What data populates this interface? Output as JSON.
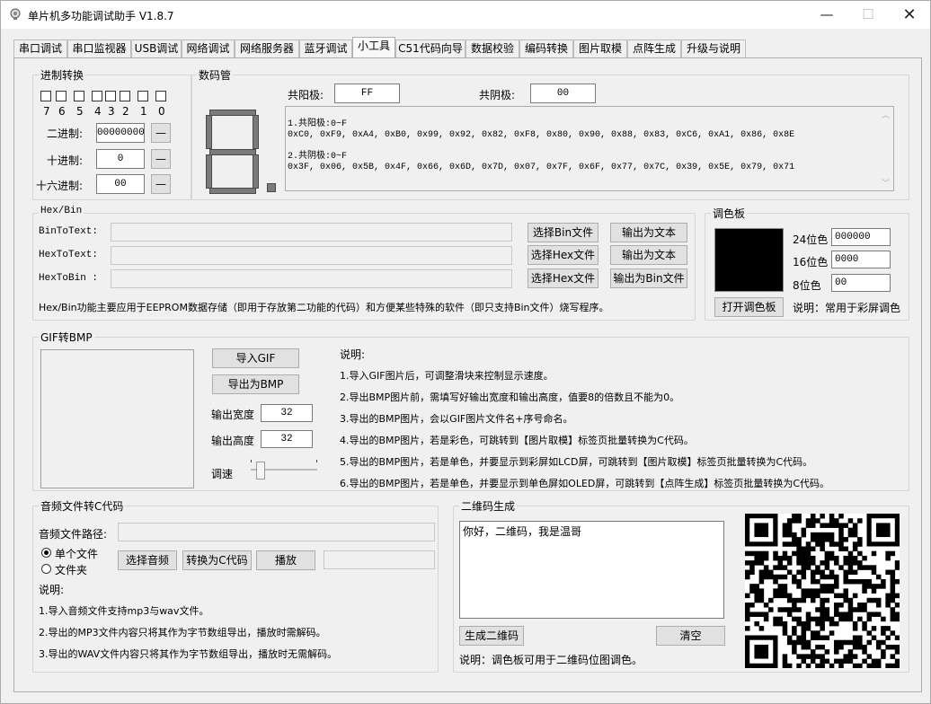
{
  "window": {
    "title": "单片机多功能调试助手 V1.8.7"
  },
  "tabs": [
    "串口调试",
    "串口监视器",
    "USB调试",
    "网络调试",
    "网络服务器",
    "蓝牙调试",
    "小工具",
    "C51代码向导",
    "数据校验",
    "编码转换",
    "图片取模",
    "点阵生成",
    "升级与说明"
  ],
  "base_convert": {
    "title": "进制转换",
    "bit_labels": [
      "7",
      "6",
      "5",
      "4",
      "3",
      "2",
      "1",
      "0"
    ],
    "binary_label": "二进制:",
    "binary_value": "00000000",
    "decimal_label": "十进制:",
    "decimal_value": "0",
    "hex_label": "十六进制:",
    "hex_value": "00",
    "minus_label": "—"
  },
  "seven_seg": {
    "title": "数码管",
    "common_anode_label": "共阳极:",
    "common_anode_value": "FF",
    "common_cathode_label": "共阴极:",
    "common_cathode_value": "00",
    "output_lines": [
      "1.共阳极:0~F",
      "0xC0, 0xF9, 0xA4, 0xB0, 0x99, 0x92, 0x82, 0xF8, 0x80, 0x90, 0x88, 0x83, 0xC6, 0xA1, 0x86, 0x8E",
      "",
      "2.共阴极:0~F",
      "0x3F, 0x06, 0x5B, 0x4F, 0x66, 0x6D, 0x7D, 0x07, 0x7F, 0x6F, 0x77, 0x7C, 0x39, 0x5E, 0x79, 0x71"
    ]
  },
  "hexbin": {
    "title": "Hex/Bin",
    "bin_to_text_label": "BinToText:",
    "hex_to_text_label": "HexToText:",
    "hex_to_bin_label": "HexToBin :",
    "select_bin": "选择Bin文件",
    "select_hex": "选择Hex文件",
    "output_text": "输出为文本",
    "output_bin": "输出为Bin文件",
    "note": "Hex/Bin功能主要应用于EEPROM数据存储（即用于存放第二功能的代码）和方便某些特殊的软件（即只支持Bin文件）烧写程序。"
  },
  "palette": {
    "title": "调色板",
    "color_hex": "#000000",
    "bit24_label": "24位色",
    "bit24_value": "000000",
    "bit16_label": "16位色",
    "bit16_value": "0000",
    "bit8_label": "8位色",
    "bit8_value": "00",
    "open_button": "打开调色板",
    "note": "说明：常用于彩屏调色"
  },
  "gif_bmp": {
    "title": "GIF转BMP",
    "import_gif": "导入GIF",
    "export_bmp": "导出为BMP",
    "width_label": "输出宽度",
    "width_value": "32",
    "height_label": "输出高度",
    "height_value": "32",
    "speed_label": "调速",
    "speed_level": 0.1,
    "note_title": "说明:",
    "notes": [
      "1.导入GIF图片后，可调整滑块来控制显示速度。",
      "2.导出BMP图片前，需填写好输出宽度和输出高度，值要8的倍数且不能为0。",
      "3.导出的BMP图片，会以GIF图片文件名+序号命名。",
      "4.导出的BMP图片，若是彩色，可跳转到【图片取模】标签页批量转换为C代码。",
      "5.导出的BMP图片，若是单色，并要显示到彩屏如LCD屏，可跳转到【图片取模】标签页批量转换为C代码。",
      "6.导出的BMP图片，若是单色，并要显示到单色屏如OLED屏，可跳转到【点阵生成】标签页批量转换为C代码。"
    ]
  },
  "audio": {
    "title": "音频文件转C代码",
    "path_label": "音频文件路径:",
    "single_file": "单个文件",
    "folder": "文件夹",
    "select_audio": "选择音频",
    "convert": "转换为C代码",
    "play": "播放",
    "note_title": "说明:",
    "notes": [
      "1.导入音频文件支持mp3与wav文件。",
      "2.导出的MP3文件内容只将其作为字节数组导出，播放时需解码。",
      "3.导出的WAV文件内容只将其作为字节数组导出，播放时无需解码。"
    ]
  },
  "qrcode": {
    "title": "二维码生成",
    "text": "你好，二维码，我是温哥",
    "generate": "生成二维码",
    "clear": "清空",
    "note": "说明：调色板可用于二维码位图调色。"
  },
  "colors": {
    "accent": "#0078d7",
    "panel": "#f0f0f0"
  }
}
